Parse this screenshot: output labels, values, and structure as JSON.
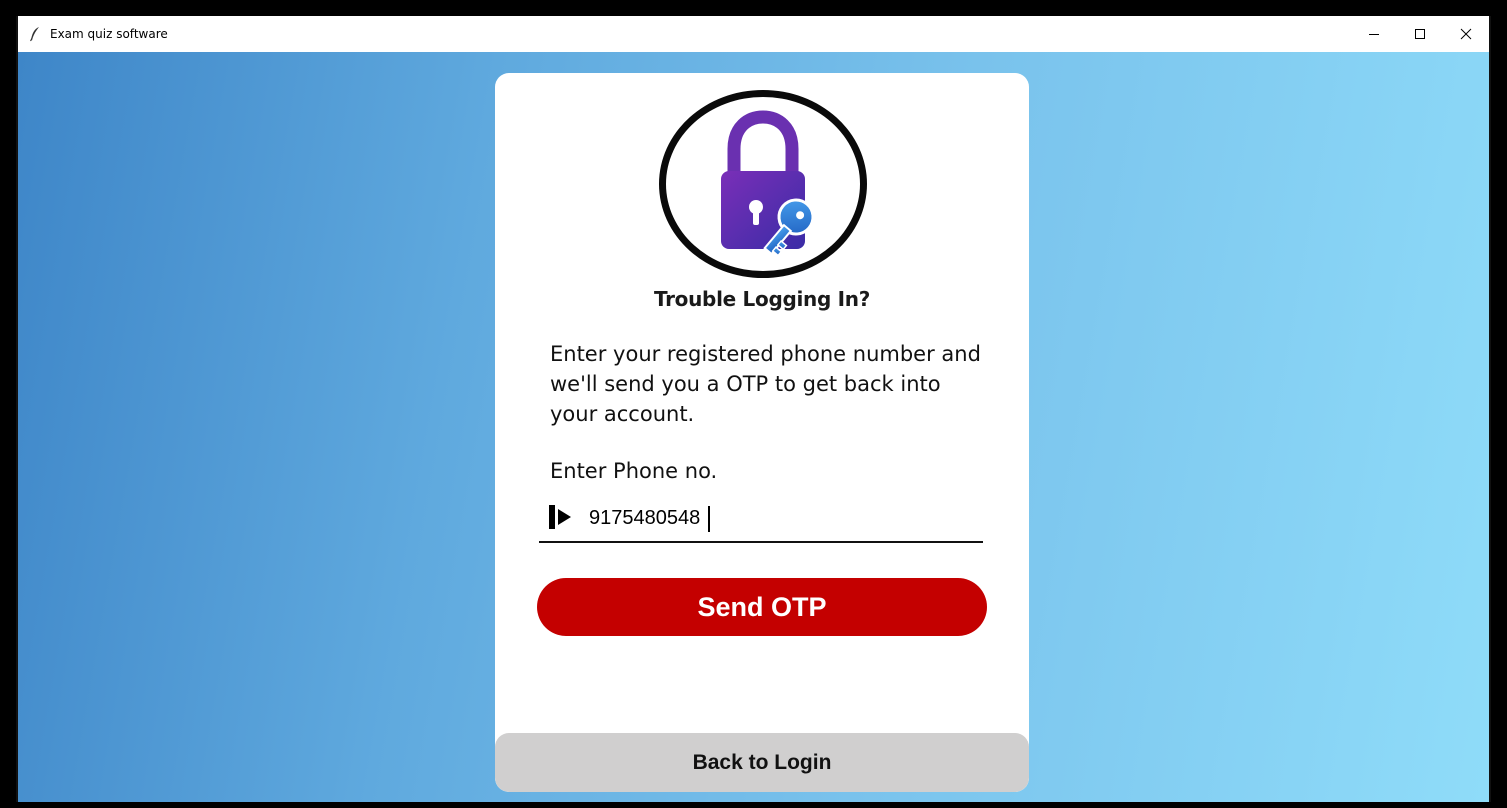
{
  "window": {
    "title": "Exam quiz software",
    "app_icon": "feather-icon",
    "controls": [
      "minimize-icon",
      "maximize-icon",
      "close-icon"
    ]
  },
  "background": {
    "gradient_colors": [
      "#3e86c8",
      "#5fa9de",
      "#79c2ec",
      "#8fdcf9"
    ]
  },
  "card": {
    "illustration_icon": "padlock-with-key-icon",
    "heading": "Trouble Logging In?",
    "description": "Enter your registered phone number and we'll send you a OTP to get back into your account.",
    "phone_label": "Enter Phone no.",
    "phone_input": {
      "icon": "arrow-right-icon",
      "value": "9175480548",
      "placeholder": ""
    },
    "send_button_label": "Send OTP",
    "back_button_label": "Back to Login"
  },
  "colors": {
    "send_button": "#c40000",
    "back_button": "#d0cfcf",
    "lock_purple": "#5b2bb0",
    "key_blue": "#2f7fd6"
  }
}
